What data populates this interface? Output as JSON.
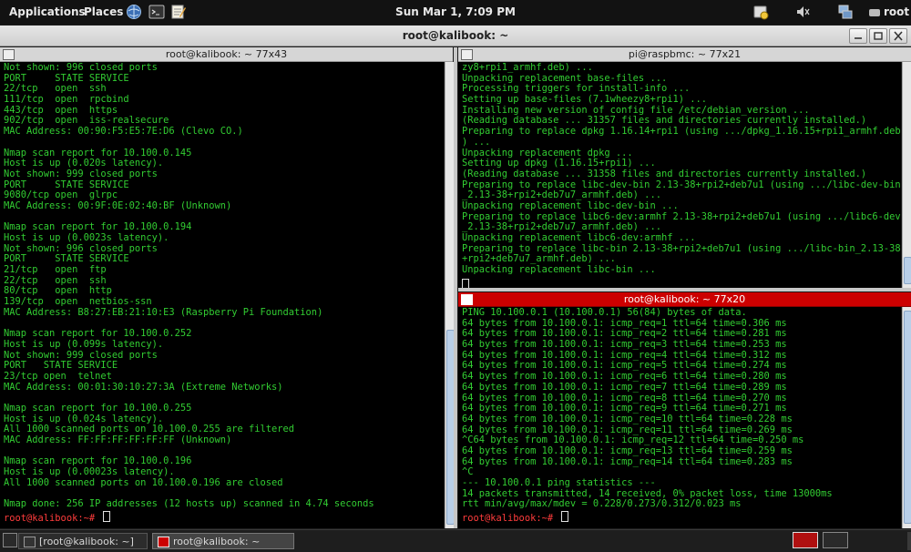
{
  "top_panel": {
    "applications": "Applications",
    "places": "Places",
    "clock": "Sun Mar  1,  7:09 PM",
    "user": "root"
  },
  "window": {
    "title": "root@kalibook: ~"
  },
  "left_pane": {
    "title": "root@kalibook: ~ 77x43",
    "lines": [
      "Not shown: 996 closed ports",
      "PORT     STATE SERVICE",
      "22/tcp   open  ssh",
      "111/tcp  open  rpcbind",
      "443/tcp  open  https",
      "902/tcp  open  iss-realsecure",
      "MAC Address: 00:90:F5:E5:7E:D6 (Clevo CO.)",
      "",
      "Nmap scan report for 10.100.0.145",
      "Host is up (0.020s latency).",
      "Not shown: 999 closed ports",
      "PORT     STATE SERVICE",
      "9080/tcp open  glrpc",
      "MAC Address: 00:9F:0E:02:40:BF (Unknown)",
      "",
      "Nmap scan report for 10.100.0.194",
      "Host is up (0.0023s latency).",
      "Not shown: 996 closed ports",
      "PORT     STATE SERVICE",
      "21/tcp   open  ftp",
      "22/tcp   open  ssh",
      "80/tcp   open  http",
      "139/tcp  open  netbios-ssn",
      "MAC Address: B8:27:EB:21:10:E3 (Raspberry Pi Foundation)",
      "",
      "Nmap scan report for 10.100.0.252",
      "Host is up (0.099s latency).",
      "Not shown: 999 closed ports",
      "PORT   STATE SERVICE",
      "23/tcp open  telnet",
      "MAC Address: 00:01:30:10:27:3A (Extreme Networks)",
      "",
      "Nmap scan report for 10.100.0.255",
      "Host is up (0.024s latency).",
      "All 1000 scanned ports on 10.100.0.255 are filtered",
      "MAC Address: FF:FF:FF:FF:FF:FF (Unknown)",
      "",
      "Nmap scan report for 10.100.0.196",
      "Host is up (0.00023s latency).",
      "All 1000 scanned ports on 10.100.0.196 are closed",
      "",
      "Nmap done: 256 IP addresses (12 hosts up) scanned in 4.74 seconds"
    ],
    "prompt": "root@kalibook:~# "
  },
  "right_top_pane": {
    "title": "pi@raspbmc: ~ 77x21",
    "lines": [
      "zy8+rpi1_armhf.deb) ...",
      "Unpacking replacement base-files ...",
      "Processing triggers for install-info ...",
      "Setting up base-files (7.1wheezy8+rpi1) ...",
      "Installing new version of config file /etc/debian_version ...",
      "(Reading database ... 31357 files and directories currently installed.)",
      "Preparing to replace dpkg 1.16.14+rpi1 (using .../dpkg_1.16.15+rpi1_armhf.deb",
      ") ...",
      "Unpacking replacement dpkg ...",
      "Setting up dpkg (1.16.15+rpi1) ...",
      "(Reading database ... 31358 files and directories currently installed.)",
      "Preparing to replace libc-dev-bin 2.13-38+rpi2+deb7u1 (using .../libc-dev-bin",
      "_2.13-38+rpi2+deb7u7_armhf.deb) ...",
      "Unpacking replacement libc-dev-bin ...",
      "Preparing to replace libc6-dev:armhf 2.13-38+rpi2+deb7u1 (using .../libc6-dev",
      "_2.13-38+rpi2+deb7u7_armhf.deb) ...",
      "Unpacking replacement libc6-dev:armhf ...",
      "Preparing to replace libc-bin 2.13-38+rpi2+deb7u1 (using .../libc-bin_2.13-38",
      "+rpi2+deb7u7_armhf.deb) ...",
      "Unpacking replacement libc-bin ..."
    ]
  },
  "right_bottom_pane": {
    "title": "root@kalibook: ~ 77x20",
    "lines": [
      "PING 10.100.0.1 (10.100.0.1) 56(84) bytes of data.",
      "64 bytes from 10.100.0.1: icmp_req=1 ttl=64 time=0.306 ms",
      "64 bytes from 10.100.0.1: icmp_req=2 ttl=64 time=0.281 ms",
      "64 bytes from 10.100.0.1: icmp_req=3 ttl=64 time=0.253 ms",
      "64 bytes from 10.100.0.1: icmp_req=4 ttl=64 time=0.312 ms",
      "64 bytes from 10.100.0.1: icmp_req=5 ttl=64 time=0.274 ms",
      "64 bytes from 10.100.0.1: icmp_req=6 ttl=64 time=0.280 ms",
      "64 bytes from 10.100.0.1: icmp_req=7 ttl=64 time=0.289 ms",
      "64 bytes from 10.100.0.1: icmp_req=8 ttl=64 time=0.270 ms",
      "64 bytes from 10.100.0.1: icmp_req=9 ttl=64 time=0.271 ms",
      "64 bytes from 10.100.0.1: icmp_req=10 ttl=64 time=0.228 ms",
      "64 bytes from 10.100.0.1: icmp_req=11 ttl=64 time=0.269 ms",
      "^C64 bytes from 10.100.0.1: icmp_req=12 ttl=64 time=0.250 ms",
      "64 bytes from 10.100.0.1: icmp_req=13 ttl=64 time=0.259 ms",
      "64 bytes from 10.100.0.1: icmp_req=14 ttl=64 time=0.283 ms",
      "^C",
      "--- 10.100.0.1 ping statistics ---",
      "14 packets transmitted, 14 received, 0% packet loss, time 13000ms",
      "rtt min/avg/max/mdev = 0.228/0.273/0.312/0.023 ms"
    ],
    "prompt": "root@kalibook:~# "
  },
  "taskbar": {
    "tasks": [
      {
        "label": "[root@kalibook: ~]"
      },
      {
        "label": "root@kalibook: ~"
      }
    ]
  },
  "colors": {
    "terminal_text": "#32cd32",
    "prompt": "#ff3c3c",
    "active_pane_header": "#cc0000"
  }
}
